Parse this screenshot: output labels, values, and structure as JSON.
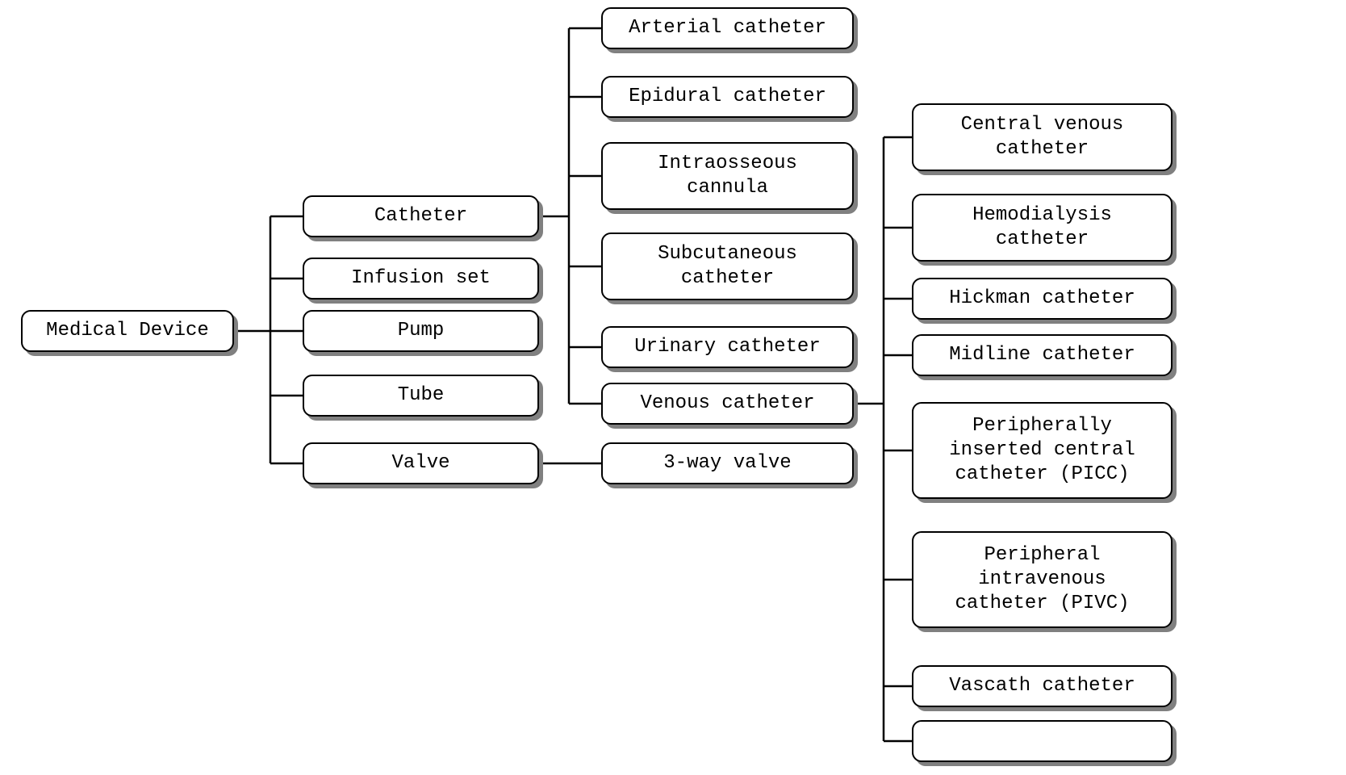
{
  "root": {
    "label": "Medical Device"
  },
  "level1": {
    "catheter": {
      "label": "Catheter"
    },
    "infusion_set": {
      "label": "Infusion set"
    },
    "pump": {
      "label": "Pump"
    },
    "tube": {
      "label": "Tube"
    },
    "valve": {
      "label": "Valve"
    }
  },
  "catheter_children": {
    "arterial": {
      "label": "Arterial catheter"
    },
    "epidural": {
      "label": "Epidural catheter"
    },
    "intraosseous": {
      "label": "Intraosseous\ncannula"
    },
    "subcutaneous": {
      "label": "Subcutaneous\ncatheter"
    },
    "urinary": {
      "label": "Urinary catheter"
    },
    "venous": {
      "label": "Venous catheter"
    }
  },
  "valve_children": {
    "three_way": {
      "label": "3-way valve"
    }
  },
  "venous_children": {
    "central_venous": {
      "label": "Central venous\ncatheter"
    },
    "hemodialysis": {
      "label": "Hemodialysis\ncatheter"
    },
    "hickman": {
      "label": "Hickman catheter"
    },
    "midline": {
      "label": "Midline catheter"
    },
    "picc": {
      "label": "Peripherally\ninserted central\ncatheter (PICC)"
    },
    "pivc": {
      "label": "Peripheral\nintravenous\ncatheter (PIVC)"
    },
    "vascath": {
      "label": "Vascath catheter"
    }
  }
}
